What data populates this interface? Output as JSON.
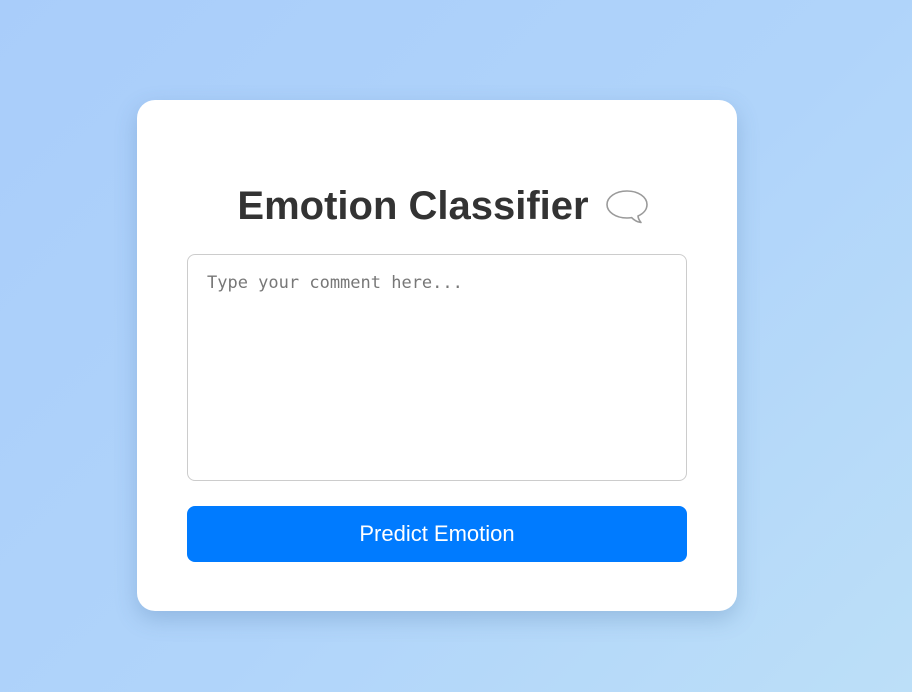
{
  "card": {
    "title": "Emotion Classifier",
    "title_icon": "speech-balloon-icon",
    "comment_input": {
      "value": "",
      "placeholder": "Type your comment here..."
    },
    "predict_button_label": "Predict Emotion"
  },
  "colors": {
    "accent": "#007bff",
    "title_text": "#333333",
    "card_background": "#ffffff",
    "page_background": "#b0d4fa"
  }
}
